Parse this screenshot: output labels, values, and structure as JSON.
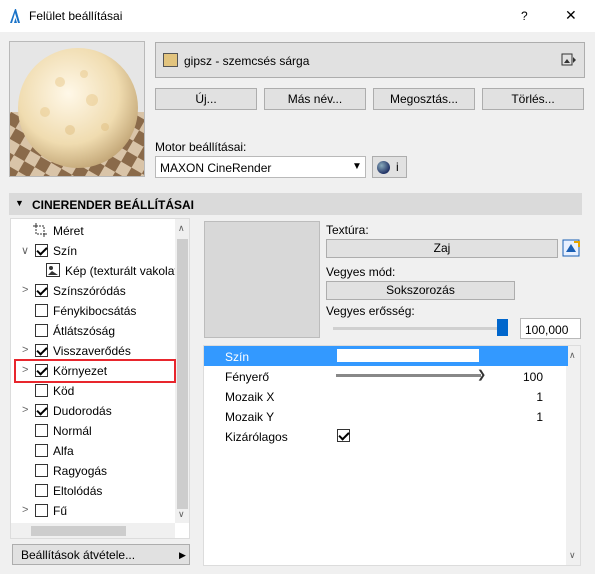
{
  "window": {
    "title": "Felület beállításai",
    "help": "?",
    "close": "✕"
  },
  "material": {
    "name": "gipsz - szemcsés sárga",
    "swatch_color": "#e2c47e"
  },
  "buttons": {
    "new": "Új...",
    "rename": "Más név...",
    "share": "Megosztás...",
    "delete": "Törlés..."
  },
  "engine": {
    "label": "Motor beállításai:",
    "value": "MAXON CineRender",
    "info": "i"
  },
  "section": {
    "title": "CINERENDER BEÁLLÍTÁSAI"
  },
  "tree": [
    {
      "label": "Méret",
      "checkbox": false,
      "checked": false,
      "chevron": "",
      "icon": "size"
    },
    {
      "label": "Szín",
      "checkbox": true,
      "checked": true,
      "chevron": "∨"
    },
    {
      "label": "Kép (texturált vakolat",
      "checkbox": false,
      "checked": false,
      "chevron": "",
      "icon": "image",
      "indent": true
    },
    {
      "label": "Színszóródás",
      "checkbox": true,
      "checked": true,
      "chevron": ">"
    },
    {
      "label": "Fénykibocsátás",
      "checkbox": true,
      "checked": false,
      "chevron": ""
    },
    {
      "label": "Átlátszóság",
      "checkbox": true,
      "checked": false,
      "chevron": ""
    },
    {
      "label": "Visszaverődés",
      "checkbox": true,
      "checked": true,
      "chevron": ">"
    },
    {
      "label": "Környezet",
      "checkbox": true,
      "checked": true,
      "chevron": ">",
      "selected": true
    },
    {
      "label": "Köd",
      "checkbox": true,
      "checked": false,
      "chevron": ""
    },
    {
      "label": "Dudorodás",
      "checkbox": true,
      "checked": true,
      "chevron": ">"
    },
    {
      "label": "Normál",
      "checkbox": true,
      "checked": false,
      "chevron": ""
    },
    {
      "label": "Alfa",
      "checkbox": true,
      "checked": false,
      "chevron": ""
    },
    {
      "label": "Ragyogás",
      "checkbox": true,
      "checked": false,
      "chevron": ""
    },
    {
      "label": "Eltolódás",
      "checkbox": true,
      "checked": false,
      "chevron": ""
    },
    {
      "label": "Fű",
      "checkbox": true,
      "checked": false,
      "chevron": ">"
    }
  ],
  "transfer_button": "Beállítások átvétele...",
  "texture": {
    "label": "Textúra:",
    "value": "Zaj"
  },
  "mix_mode": {
    "label": "Vegyes mód:",
    "value": "Sokszorozás"
  },
  "mix_strength": {
    "label": "Vegyes erősség:",
    "value": "100,000",
    "level": 1.0
  },
  "props": [
    {
      "name": "Szín",
      "value": "",
      "selected": true
    },
    {
      "name": "Fényerő",
      "value": "100",
      "slider": 1.0
    },
    {
      "name": "Mozaik X",
      "value": "1"
    },
    {
      "name": "Mozaik Y",
      "value": "1"
    },
    {
      "name": "Kizárólagos",
      "value": "",
      "checkbox": true
    }
  ]
}
